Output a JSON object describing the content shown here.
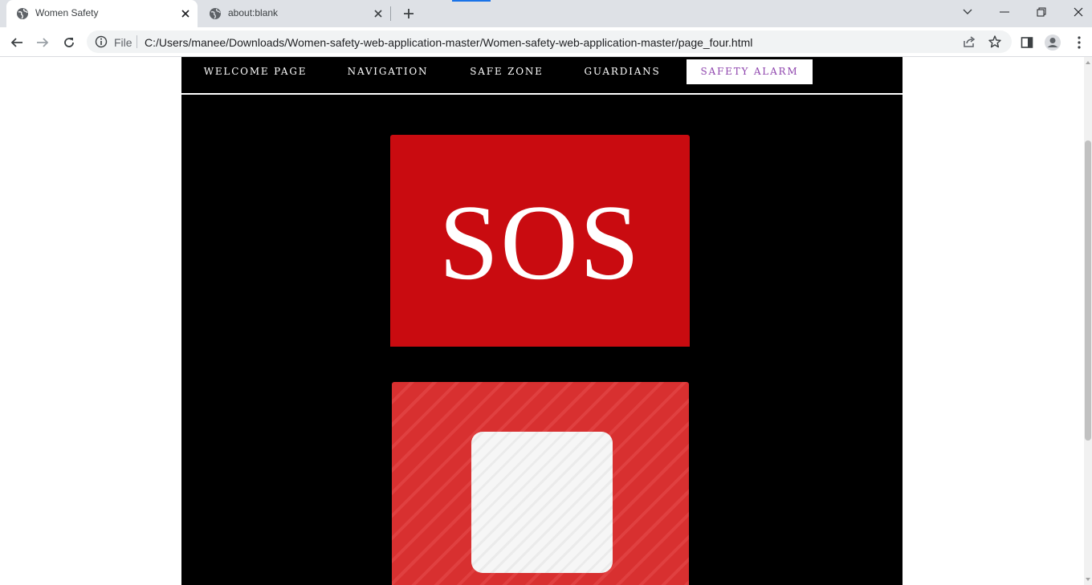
{
  "browser": {
    "tabs": [
      {
        "title": "Women Safety",
        "active": true
      },
      {
        "title": "about:blank",
        "active": false
      }
    ],
    "omnibox": {
      "scheme_label": "File",
      "url": "C:/Users/manee/Downloads/Women-safety-web-application-master/Women-safety-web-application-master/page_four.html"
    }
  },
  "page": {
    "nav": [
      {
        "label": "WELCOME PAGE",
        "active": false
      },
      {
        "label": "NAVIGATION",
        "active": false
      },
      {
        "label": "SAFE ZONE",
        "active": false
      },
      {
        "label": "GUARDIANS",
        "active": false
      },
      {
        "label": "SAFETY ALARM",
        "active": true
      }
    ],
    "sos_label": "SOS"
  },
  "colors": {
    "page_background": "#000000",
    "sos_red": "#c90b10",
    "stop_red": "#d83030",
    "active_nav_text": "#8e44ad"
  },
  "icons": [
    "globe-icon",
    "close-icon",
    "plus-icon",
    "chevron-down-icon",
    "minimize-icon",
    "restore-icon",
    "close-window-icon",
    "back-arrow-icon",
    "forward-arrow-icon",
    "reload-icon",
    "info-icon",
    "share-icon",
    "star-icon",
    "side-panel-icon",
    "profile-icon",
    "kebab-menu-icon",
    "stop-icon"
  ]
}
